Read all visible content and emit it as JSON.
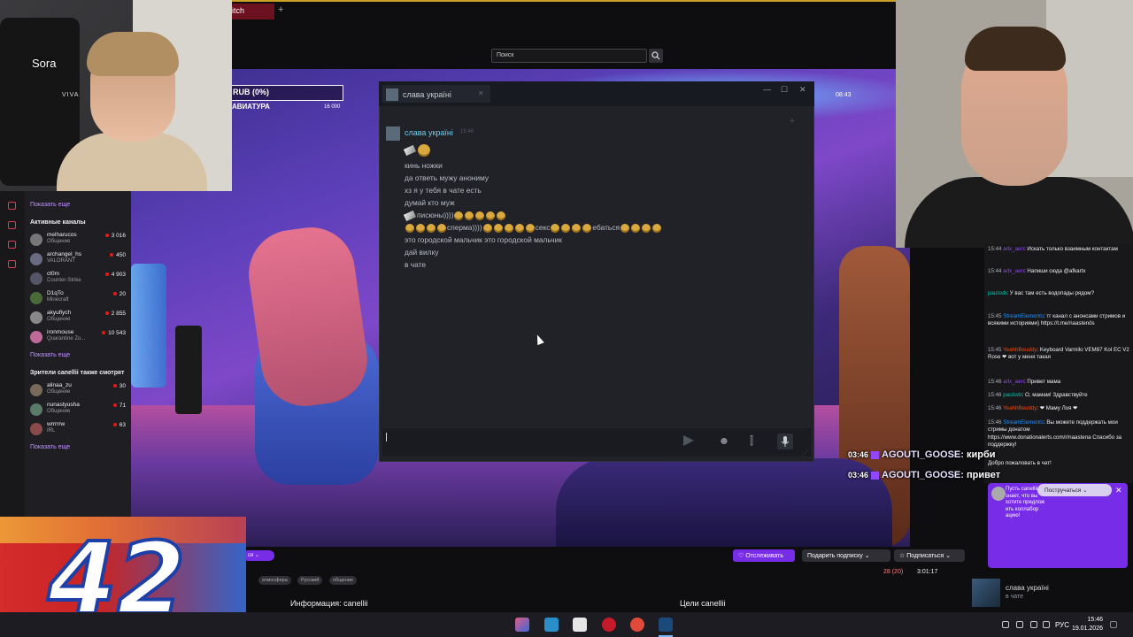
{
  "browser": {
    "tab_label": "itch",
    "new_tab": "+",
    "search_placeholder": "Поиск"
  },
  "webcam_left": {
    "name": "Sora",
    "watermark": "VIVA"
  },
  "stream_overlay": {
    "rub": "RUB (0%)",
    "aviator": "АВИАТУРА",
    "aviator_value": "16 000",
    "timer": "08:43"
  },
  "sidebar": {
    "show_more_1": "Показать еще",
    "active_channels": "Активные каналы",
    "channels": [
      {
        "name": "melharucos",
        "game": "Общение",
        "viewers": "3 016"
      },
      {
        "name": "archangel_hs",
        "game": "VALORANT",
        "viewers": "450"
      },
      {
        "name": "ct0m",
        "game": "Counter-Strike",
        "viewers": "4 903"
      },
      {
        "name": "D1qTo",
        "game": "Minecraft",
        "viewers": "20"
      },
      {
        "name": "akyuflych",
        "game": "Общение",
        "viewers": "2 855"
      },
      {
        "name": "ironmouse",
        "game": "Quarantine Zo...",
        "viewers": "10 543"
      }
    ],
    "show_more_2": "Показать еще",
    "viewers_also_watch": "Зрители canellii также смотрят",
    "also": [
      {
        "name": "alinaa_zu",
        "game": "Общение",
        "viewers": "30"
      },
      {
        "name": "nunastyusha",
        "game": "Общение",
        "viewers": "71"
      },
      {
        "name": "wrrrrrw",
        "game": "IRL",
        "viewers": "63"
      }
    ],
    "show_more_3": "Показать еще"
  },
  "logo": {
    "number": "42"
  },
  "stream_info": {
    "tags": [
      "атмосфера",
      "Русский",
      "общение"
    ],
    "follow": "♡ Отслеживать",
    "gift": "Подарить подписку ⌄",
    "subscribe": "☆ Подписаться ⌄",
    "viewers": "28 (20)",
    "uptime": "3:01:17",
    "info_title": "Информация: canellii",
    "goals_title": "Цели canellii",
    "pill": "ся ⌄"
  },
  "steam_chat": {
    "tab_title": "слава україні",
    "sender": "слава україні",
    "sender_time": "15:46",
    "lines": [
      {
        "text": "кинь ножки"
      },
      {
        "text": "да ответь мужу анониму"
      },
      {
        "text": "хз я у тебя в чате есть"
      },
      {
        "text": "думай кто муж"
      },
      {
        "pre": "писюны))))",
        "emo": 5
      },
      {
        "a": "сперма))))",
        "b": "секс",
        "c": "ебаться"
      },
      {
        "text": "это городской мальчик это городской мальчик"
      },
      {
        "text": "дай вилку"
      },
      {
        "text": "в чате"
      }
    ]
  },
  "twitch_chat": {
    "messages": [
      {
        "time": "15:44",
        "user": "arlx_aen",
        "text": "Искать только взаимным контактам"
      },
      {
        "time": "15:44",
        "user": "arlx_aen",
        "text": "Напиши сюда @afkartx"
      },
      {
        "time": "",
        "user": "paulsvb",
        "text": "У вас там есть водопады рядом?"
      },
      {
        "time": "15:45",
        "user": "StreamElements",
        "text": "тг канал с анонсами стримов и всякими историями) https://t.me/naastenös"
      },
      {
        "time": "15:45",
        "user": "YeahhBeuddy",
        "text": "Keyboard Varmilo VEM87 Kol EC V2 Rose ❤ вот у меня такая"
      },
      {
        "time": "15:46",
        "user": "arlx_aen",
        "text": "Привет мама"
      },
      {
        "time": "15:46",
        "user": "paulsvb",
        "text": "О, мамам! Здравствуйте"
      },
      {
        "time": "15:46",
        "user": "YeahhBeuddy",
        "text": "❤ Маму Лоя ❤"
      },
      {
        "time": "15:46",
        "user": "StreamElements",
        "text": "Вы можете поддержать мои стримы донатом https://www.donationalerts.com/r/naastena Спасибо за поддержку!"
      },
      {
        "time": "",
        "user": "",
        "text": "Добро пожаловать в чат!"
      }
    ],
    "alert_text": "Пусть canellii знает, что вы хотите предлож ить коллабор ацию!",
    "subscribe_pill": "Постручаться ⌄"
  },
  "overlay_chat": [
    {
      "time": "03:46",
      "user": "AGOUTI_GOOSE:",
      "text": "кирби"
    },
    {
      "time": "03:46",
      "user": "AGOUTI_GOOSE:",
      "text": "привет"
    }
  ],
  "steam_friend": {
    "name": "слава україні",
    "status": "в чате"
  },
  "taskbar": {
    "lang": "РУС",
    "time": "15:46",
    "date": "19.01.2026"
  }
}
